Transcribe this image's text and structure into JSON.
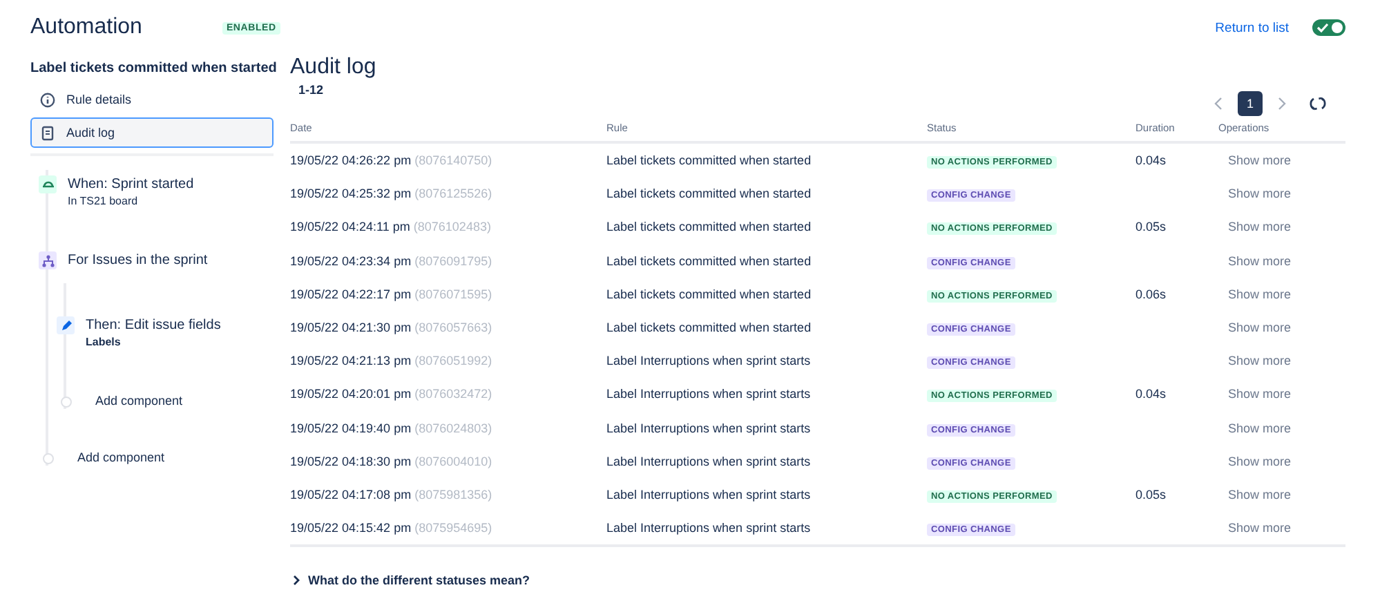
{
  "header": {
    "title": "Automation",
    "status_badge": "ENABLED",
    "return_link": "Return to list",
    "rule_enabled": {
      "on": true
    }
  },
  "sidebar": {
    "rule_name": "Label tickets committed when started",
    "items": [
      {
        "label": "Rule details",
        "kind": "info",
        "selected": false
      },
      {
        "label": "Audit log",
        "kind": "document",
        "selected": true
      }
    ],
    "flow": [
      {
        "kind": "trigger",
        "title": "When: Sprint started",
        "subtitle": "In TS21 board"
      },
      {
        "kind": "branch",
        "title": "For Issues in the sprint",
        "children": [
          {
            "kind": "action",
            "title": "Then: Edit issue fields",
            "subtitle": "Labels"
          },
          {
            "kind": "add",
            "title": "Add component"
          }
        ]
      },
      {
        "kind": "add",
        "title": "Add component"
      }
    ]
  },
  "audit_log": {
    "title": "Audit log",
    "range": "1-12",
    "pagination": {
      "pages": [
        {
          "label": "1",
          "selected": true
        }
      ]
    },
    "table": {
      "columns": [
        "Date",
        "Rule",
        "Status",
        "Duration",
        "Operations"
      ],
      "rows": [
        {
          "date": "19/05/22 04:26:22 pm",
          "id": "(8076140750)",
          "rule": "Label tickets committed when started",
          "status": {
            "kind": "no_actions",
            "label": "NO ACTIONS PERFORMED"
          },
          "duration": "0.04s",
          "operation": "Show more"
        },
        {
          "date": "19/05/22 04:25:32 pm",
          "id": "(8076125526)",
          "rule": "Label tickets committed when started",
          "status": {
            "kind": "config",
            "label": "CONFIG CHANGE"
          },
          "operation": "Show more"
        },
        {
          "date": "19/05/22 04:24:11 pm",
          "id": "(8076102483)",
          "rule": "Label tickets committed when started",
          "status": {
            "kind": "no_actions",
            "label": "NO ACTIONS PERFORMED"
          },
          "duration": "0.05s",
          "operation": "Show more"
        },
        {
          "date": "19/05/22 04:23:34 pm",
          "id": "(8076091795)",
          "rule": "Label tickets committed when started",
          "status": {
            "kind": "config",
            "label": "CONFIG CHANGE"
          },
          "operation": "Show more"
        },
        {
          "date": "19/05/22 04:22:17 pm",
          "id": "(8076071595)",
          "rule": "Label tickets committed when started",
          "status": {
            "kind": "no_actions",
            "label": "NO ACTIONS PERFORMED"
          },
          "duration": "0.06s",
          "operation": "Show more"
        },
        {
          "date": "19/05/22 04:21:30 pm",
          "id": "(8076057663)",
          "rule": "Label tickets committed when started",
          "status": {
            "kind": "config",
            "label": "CONFIG CHANGE"
          },
          "operation": "Show more"
        },
        {
          "date": "19/05/22 04:21:13 pm",
          "id": "(8076051992)",
          "rule": "Label Interruptions when sprint starts",
          "status": {
            "kind": "config",
            "label": "CONFIG CHANGE"
          },
          "operation": "Show more"
        },
        {
          "date": "19/05/22 04:20:01 pm",
          "id": "(8076032472)",
          "rule": "Label Interruptions when sprint starts",
          "status": {
            "kind": "no_actions",
            "label": "NO ACTIONS PERFORMED"
          },
          "duration": "0.04s",
          "operation": "Show more"
        },
        {
          "date": "19/05/22 04:19:40 pm",
          "id": "(8076024803)",
          "rule": "Label Interruptions when sprint starts",
          "status": {
            "kind": "config",
            "label": "CONFIG CHANGE"
          },
          "operation": "Show more"
        },
        {
          "date": "19/05/22 04:18:30 pm",
          "id": "(8076004010)",
          "rule": "Label Interruptions when sprint starts",
          "status": {
            "kind": "config",
            "label": "CONFIG CHANGE"
          },
          "operation": "Show more"
        },
        {
          "date": "19/05/22 04:17:08 pm",
          "id": "(8075981356)",
          "rule": "Label Interruptions when sprint starts",
          "status": {
            "kind": "no_actions",
            "label": "NO ACTIONS PERFORMED"
          },
          "duration": "0.05s",
          "operation": "Show more"
        },
        {
          "date": "19/05/22 04:15:42 pm",
          "id": "(8075954695)",
          "rule": "Label Interruptions when sprint starts",
          "status": {
            "kind": "config",
            "label": "CONFIG CHANGE"
          },
          "operation": "Show more"
        }
      ]
    },
    "help": {
      "label": "What do the different statuses mean?",
      "expanded": false
    }
  }
}
